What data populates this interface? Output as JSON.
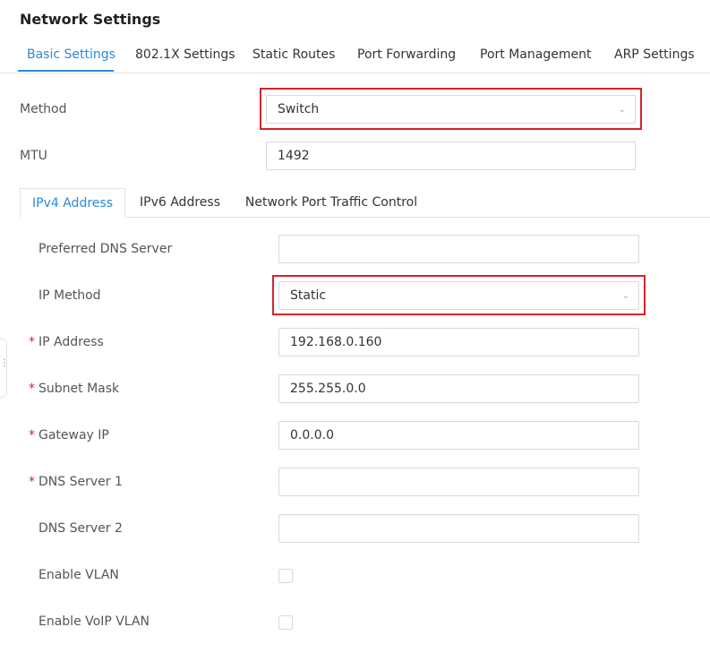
{
  "page": {
    "title": "Network Settings"
  },
  "tabs": [
    {
      "label": "Basic Settings",
      "active": true
    },
    {
      "label": "802.1X Settings"
    },
    {
      "label": "Static Routes"
    },
    {
      "label": "Port Forwarding"
    },
    {
      "label": "Port Management"
    },
    {
      "label": "ARP Settings"
    }
  ],
  "method": {
    "label": "Method",
    "value": "Switch"
  },
  "mtu": {
    "label": "MTU",
    "value": "1492"
  },
  "subtabs": [
    {
      "label": "IPv4 Address",
      "active": true
    },
    {
      "label": "IPv6 Address"
    },
    {
      "label": "Network Port Traffic Control"
    }
  ],
  "ipv4": {
    "preferred_dns": {
      "label": "Preferred DNS Server",
      "value": ""
    },
    "ip_method": {
      "label": "IP Method",
      "value": "Static"
    },
    "ip_address": {
      "label": "IP Address",
      "value": "192.168.0.160",
      "required": "*"
    },
    "subnet_mask": {
      "label": "Subnet Mask",
      "value": "255.255.0.0",
      "required": "*"
    },
    "gateway_ip": {
      "label": "Gateway IP",
      "value": "0.0.0.0",
      "required": "*"
    },
    "dns_server_1": {
      "label": "DNS Server 1",
      "value": "",
      "required": "*"
    },
    "dns_server_2": {
      "label": "DNS Server 2",
      "value": ""
    },
    "enable_vlan": {
      "label": "Enable VLAN",
      "checked": false
    },
    "enable_voip_vlan": {
      "label": "Enable VoIP VLAN",
      "checked": false
    }
  },
  "colors": {
    "accent": "#2b8ad8",
    "highlight": "#d4242b",
    "required": "#d4242b"
  },
  "icons": {
    "select_arrow": "chevron-down-icon"
  }
}
